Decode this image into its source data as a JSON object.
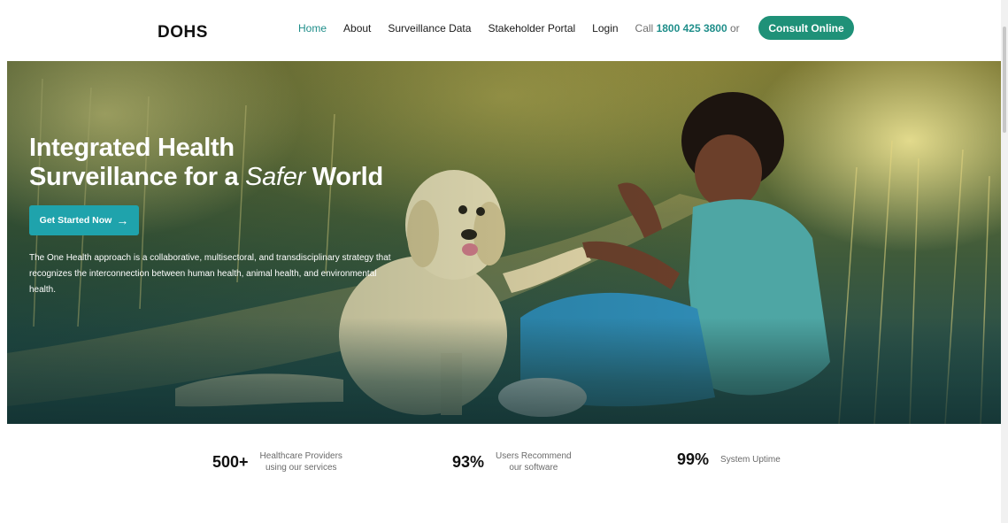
{
  "nav": {
    "logo": "DOHS",
    "links": [
      {
        "label": "Home",
        "active": true
      },
      {
        "label": "About"
      },
      {
        "label": "Surveillance Data"
      },
      {
        "label": "Stakeholder Portal"
      },
      {
        "label": "Login"
      }
    ],
    "call_prefix": "Call",
    "call_number": "1800 425 3800",
    "call_suffix": "or",
    "consult_button": "Consult Online"
  },
  "hero": {
    "title_line1": "Integrated Health",
    "title_line2_start": "Surveillance for a",
    "title_line2_em": "Safer",
    "title_line2_end": "World",
    "cta_label": "Get Started Now",
    "cta_icon": "arrow-right-icon",
    "description": "The One Health approach is a collaborative, multisectoral, and transdisciplinary strategy that recognizes the interconnection between human health, animal health, and environmental health."
  },
  "stats": [
    {
      "number": "500+",
      "label_line1": "Healthcare Providers",
      "label_line2": "using our services"
    },
    {
      "number": "93%",
      "label_line1": "Users Recommend",
      "label_line2": "our software"
    },
    {
      "number": "99%",
      "label_line1": "System Uptime",
      "label_line2": ""
    }
  ],
  "colors": {
    "accent": "#1f8e8a",
    "consult_button": "#1f9178",
    "cta_button": "#1fa3ac"
  }
}
